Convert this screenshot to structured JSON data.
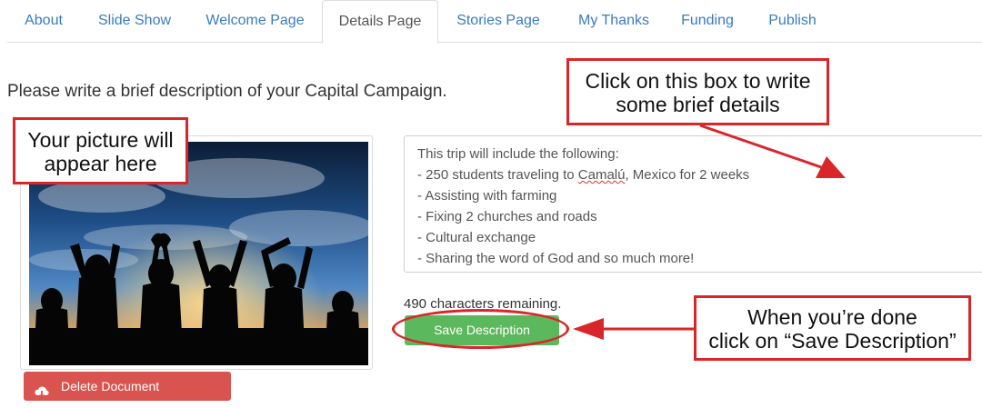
{
  "tabs": [
    {
      "label": "About"
    },
    {
      "label": "Slide Show"
    },
    {
      "label": "Welcome Page"
    },
    {
      "label": "Details Page",
      "active": true
    },
    {
      "label": "Stories Page"
    },
    {
      "label": "My Thanks"
    },
    {
      "label": "Funding"
    },
    {
      "label": "Publish"
    }
  ],
  "main": {
    "prompt": "Please write a brief description of your Capital Campaign.",
    "description_lines": [
      "This trip will include the following:",
      "- 250 students traveling to ",
      "- Assisting with farming",
      "- Fixing 2 churches and roads",
      "- Cultural exchange",
      "- Sharing the word of God and so much more!"
    ],
    "misspelled_word": "Camalú",
    "line2_suffix": ", Mexico for 2 weeks",
    "chars_remaining": "490 characters remaining.",
    "save_label": "Save Description",
    "delete_label": "Delete Document"
  },
  "annotations": {
    "picture": {
      "line1": "Your picture will",
      "line2": "appear here"
    },
    "box": {
      "line1": "Click on this box to write",
      "line2": "some brief details"
    },
    "done": {
      "line1": "When you’re done",
      "line2": "click on “Save Description”"
    }
  },
  "colors": {
    "link": "#3a7bbf",
    "save": "#5cb85c",
    "delete": "#d9534f",
    "annotation_red": "#d9262a"
  },
  "icons": {
    "delete": "cloud-download-icon"
  }
}
